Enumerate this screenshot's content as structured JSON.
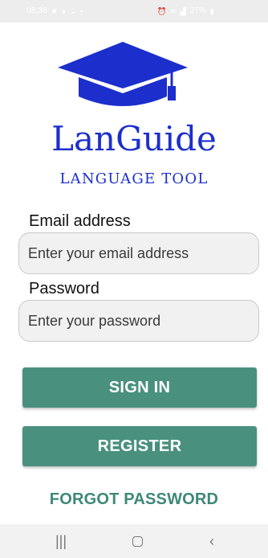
{
  "status_bar": {
    "time": "08:38",
    "left_icons": [
      "settings-gear-icon",
      "message-icon",
      "download-icon"
    ],
    "extra_dot": "•",
    "right_icons": [
      "alarm-icon",
      "wifi-icon",
      "signal-icon"
    ],
    "battery_text": "27%",
    "battery_icon": "battery-icon"
  },
  "brand": {
    "logo_icon": "graduation-cap-icon",
    "title": "LanGuide",
    "subtitle": "LANGUAGE TOOL",
    "color": "#1c2fcc"
  },
  "form": {
    "email_label": "Email address",
    "email_placeholder": "Enter your email address",
    "email_value": "",
    "password_label": "Password",
    "password_placeholder": "Enter your password",
    "password_value": ""
  },
  "actions": {
    "sign_in_label": "SIGN IN",
    "register_label": "REGISTER",
    "forgot_password_label": "FORGOT PASSWORD",
    "button_color": "#4a907e",
    "link_color": "#3e8878"
  },
  "nav_bar": {
    "recent_icon": "recent-apps-icon",
    "home_icon": "home-icon",
    "back_icon": "back-icon"
  }
}
